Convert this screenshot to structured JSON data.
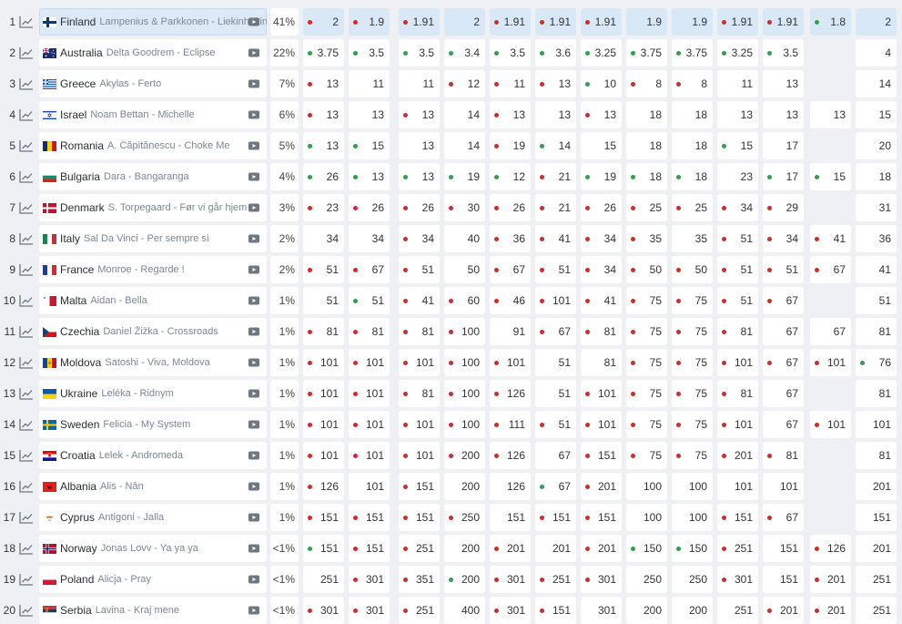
{
  "columns_left": [
    333,
    383,
    438,
    488,
    538,
    588,
    638,
    688,
    738,
    788,
    838,
    890,
    940
  ],
  "rows": [
    {
      "rank": "1",
      "country": "Finland",
      "song": "Lampenius & Parkkonen - Liekinheitin",
      "pct": "41%",
      "flag": "fi",
      "highlight": true,
      "odds": [
        {
          "v": "2",
          "d": "dn"
        },
        {
          "v": "1.9",
          "d": "dn"
        },
        {
          "v": "1.91",
          "d": "dn"
        },
        {
          "v": "2",
          "d": ""
        },
        {
          "v": "1.91",
          "d": "dn"
        },
        {
          "v": "1.91",
          "d": "dn"
        },
        {
          "v": "1.91",
          "d": "dn"
        },
        {
          "v": "1.9",
          "d": ""
        },
        {
          "v": "1.9",
          "d": ""
        },
        {
          "v": "1.91",
          "d": "dn"
        },
        {
          "v": "1.91",
          "d": "dn"
        },
        {
          "v": "1.8",
          "d": "up"
        },
        {
          "v": "2",
          "d": ""
        }
      ]
    },
    {
      "rank": "2",
      "country": "Australia",
      "song": "Delta Goodrem - Eclipse",
      "pct": "22%",
      "flag": "au",
      "odds": [
        {
          "v": "3.75",
          "d": "up"
        },
        {
          "v": "3.5",
          "d": "up"
        },
        {
          "v": "3.5",
          "d": "up"
        },
        {
          "v": "3.4",
          "d": "up"
        },
        {
          "v": "3.5",
          "d": "up"
        },
        {
          "v": "3.6",
          "d": "up"
        },
        {
          "v": "3.25",
          "d": "up"
        },
        {
          "v": "3.75",
          "d": "up"
        },
        {
          "v": "3.75",
          "d": "up"
        },
        {
          "v": "3.25",
          "d": "up"
        },
        {
          "v": "3.5",
          "d": "up"
        },
        {
          "v": "",
          "d": ""
        },
        {
          "v": "4",
          "d": ""
        }
      ]
    },
    {
      "rank": "3",
      "country": "Greece",
      "song": "Akylas - Ferto",
      "pct": "7%",
      "flag": "gr",
      "odds": [
        {
          "v": "13",
          "d": "dn"
        },
        {
          "v": "11",
          "d": ""
        },
        {
          "v": "11",
          "d": ""
        },
        {
          "v": "12",
          "d": "dn"
        },
        {
          "v": "11",
          "d": "dn"
        },
        {
          "v": "13",
          "d": "dn"
        },
        {
          "v": "10",
          "d": "up"
        },
        {
          "v": "8",
          "d": "dn"
        },
        {
          "v": "8",
          "d": "dn"
        },
        {
          "v": "11",
          "d": ""
        },
        {
          "v": "13",
          "d": ""
        },
        {
          "v": "",
          "d": ""
        },
        {
          "v": "14",
          "d": ""
        }
      ]
    },
    {
      "rank": "4",
      "country": "Israel",
      "song": "Noam Bettan - Michelle",
      "pct": "6%",
      "flag": "il",
      "odds": [
        {
          "v": "13",
          "d": "dn"
        },
        {
          "v": "13",
          "d": ""
        },
        {
          "v": "13",
          "d": "dn"
        },
        {
          "v": "14",
          "d": ""
        },
        {
          "v": "13",
          "d": "dn"
        },
        {
          "v": "13",
          "d": ""
        },
        {
          "v": "13",
          "d": "dn"
        },
        {
          "v": "18",
          "d": ""
        },
        {
          "v": "18",
          "d": ""
        },
        {
          "v": "13",
          "d": ""
        },
        {
          "v": "13",
          "d": ""
        },
        {
          "v": "13",
          "d": ""
        },
        {
          "v": "15",
          "d": ""
        }
      ]
    },
    {
      "rank": "5",
      "country": "Romania",
      "song": "A. Căpitănescu - Choke Me",
      "pct": "5%",
      "flag": "ro",
      "odds": [
        {
          "v": "13",
          "d": "up"
        },
        {
          "v": "15",
          "d": "up"
        },
        {
          "v": "13",
          "d": ""
        },
        {
          "v": "14",
          "d": ""
        },
        {
          "v": "19",
          "d": "dn"
        },
        {
          "v": "14",
          "d": "up"
        },
        {
          "v": "15",
          "d": ""
        },
        {
          "v": "18",
          "d": ""
        },
        {
          "v": "18",
          "d": ""
        },
        {
          "v": "15",
          "d": "up"
        },
        {
          "v": "17",
          "d": ""
        },
        {
          "v": "",
          "d": ""
        },
        {
          "v": "20",
          "d": ""
        }
      ]
    },
    {
      "rank": "6",
      "country": "Bulgaria",
      "song": "Dara - Bangaranga",
      "pct": "4%",
      "flag": "bg",
      "odds": [
        {
          "v": "26",
          "d": "up"
        },
        {
          "v": "13",
          "d": "up"
        },
        {
          "v": "13",
          "d": "up"
        },
        {
          "v": "19",
          "d": "up"
        },
        {
          "v": "12",
          "d": "up"
        },
        {
          "v": "21",
          "d": "dn"
        },
        {
          "v": "19",
          "d": "up"
        },
        {
          "v": "18",
          "d": "up"
        },
        {
          "v": "18",
          "d": "up"
        },
        {
          "v": "23",
          "d": ""
        },
        {
          "v": "17",
          "d": "up"
        },
        {
          "v": "15",
          "d": "up"
        },
        {
          "v": "18",
          "d": ""
        }
      ]
    },
    {
      "rank": "7",
      "country": "Denmark",
      "song": "S. Torpegaard - Før vi går hjem",
      "pct": "3%",
      "flag": "dk",
      "odds": [
        {
          "v": "23",
          "d": "dn"
        },
        {
          "v": "26",
          "d": "dn"
        },
        {
          "v": "26",
          "d": "dn"
        },
        {
          "v": "30",
          "d": "dn"
        },
        {
          "v": "26",
          "d": "dn"
        },
        {
          "v": "21",
          "d": "dn"
        },
        {
          "v": "26",
          "d": "dn"
        },
        {
          "v": "25",
          "d": "dn"
        },
        {
          "v": "25",
          "d": "dn"
        },
        {
          "v": "34",
          "d": "dn"
        },
        {
          "v": "29",
          "d": "dn"
        },
        {
          "v": "",
          "d": ""
        },
        {
          "v": "31",
          "d": ""
        }
      ]
    },
    {
      "rank": "8",
      "country": "Italy",
      "song": "Sal Da Vinci - Per sempre sì",
      "pct": "2%",
      "flag": "it",
      "odds": [
        {
          "v": "34",
          "d": ""
        },
        {
          "v": "34",
          "d": ""
        },
        {
          "v": "34",
          "d": "dn"
        },
        {
          "v": "40",
          "d": ""
        },
        {
          "v": "36",
          "d": "dn"
        },
        {
          "v": "41",
          "d": "dn"
        },
        {
          "v": "34",
          "d": "dn"
        },
        {
          "v": "35",
          "d": "dn"
        },
        {
          "v": "35",
          "d": ""
        },
        {
          "v": "51",
          "d": "dn"
        },
        {
          "v": "34",
          "d": "dn"
        },
        {
          "v": "41",
          "d": "dn"
        },
        {
          "v": "36",
          "d": ""
        }
      ]
    },
    {
      "rank": "9",
      "country": "France",
      "song": "Monroe - Regarde !",
      "pct": "2%",
      "flag": "fr",
      "odds": [
        {
          "v": "51",
          "d": "dn"
        },
        {
          "v": "67",
          "d": "dn"
        },
        {
          "v": "51",
          "d": "dn"
        },
        {
          "v": "50",
          "d": ""
        },
        {
          "v": "67",
          "d": "dn"
        },
        {
          "v": "51",
          "d": "dn"
        },
        {
          "v": "34",
          "d": "dn"
        },
        {
          "v": "50",
          "d": "dn"
        },
        {
          "v": "50",
          "d": "dn"
        },
        {
          "v": "51",
          "d": "dn"
        },
        {
          "v": "51",
          "d": "dn"
        },
        {
          "v": "67",
          "d": "dn"
        },
        {
          "v": "41",
          "d": ""
        }
      ]
    },
    {
      "rank": "10",
      "country": "Malta",
      "song": "Aidan - Bella",
      "pct": "1%",
      "flag": "mt",
      "odds": [
        {
          "v": "51",
          "d": ""
        },
        {
          "v": "51",
          "d": "up"
        },
        {
          "v": "41",
          "d": "dn"
        },
        {
          "v": "60",
          "d": "dn"
        },
        {
          "v": "46",
          "d": "dn"
        },
        {
          "v": "101",
          "d": "dn"
        },
        {
          "v": "41",
          "d": "dn"
        },
        {
          "v": "75",
          "d": "dn"
        },
        {
          "v": "75",
          "d": "dn"
        },
        {
          "v": "51",
          "d": "dn"
        },
        {
          "v": "67",
          "d": "dn"
        },
        {
          "v": "",
          "d": ""
        },
        {
          "v": "51",
          "d": ""
        }
      ]
    },
    {
      "rank": "11",
      "country": "Czechia",
      "song": "Daniel Žižka - Crossroads",
      "pct": "1%",
      "flag": "cz",
      "odds": [
        {
          "v": "81",
          "d": "dn"
        },
        {
          "v": "81",
          "d": "dn"
        },
        {
          "v": "81",
          "d": "dn"
        },
        {
          "v": "100",
          "d": "dn"
        },
        {
          "v": "91",
          "d": ""
        },
        {
          "v": "67",
          "d": "dn"
        },
        {
          "v": "81",
          "d": "dn"
        },
        {
          "v": "75",
          "d": "dn"
        },
        {
          "v": "75",
          "d": "dn"
        },
        {
          "v": "81",
          "d": "dn"
        },
        {
          "v": "67",
          "d": ""
        },
        {
          "v": "67",
          "d": ""
        },
        {
          "v": "81",
          "d": ""
        }
      ]
    },
    {
      "rank": "12",
      "country": "Moldova",
      "song": "Satoshi - Viva, Moldova",
      "pct": "1%",
      "flag": "md",
      "odds": [
        {
          "v": "101",
          "d": "dn"
        },
        {
          "v": "101",
          "d": "dn"
        },
        {
          "v": "101",
          "d": "dn"
        },
        {
          "v": "100",
          "d": "dn"
        },
        {
          "v": "101",
          "d": "dn"
        },
        {
          "v": "51",
          "d": ""
        },
        {
          "v": "81",
          "d": ""
        },
        {
          "v": "75",
          "d": "dn"
        },
        {
          "v": "75",
          "d": "dn"
        },
        {
          "v": "101",
          "d": "dn"
        },
        {
          "v": "67",
          "d": "dn"
        },
        {
          "v": "101",
          "d": "dn"
        },
        {
          "v": "76",
          "d": "up"
        }
      ]
    },
    {
      "rank": "13",
      "country": "Ukraine",
      "song": "Leléka - Ridnym",
      "pct": "1%",
      "flag": "ua",
      "odds": [
        {
          "v": "101",
          "d": "dn"
        },
        {
          "v": "101",
          "d": "dn"
        },
        {
          "v": "81",
          "d": "dn"
        },
        {
          "v": "100",
          "d": "dn"
        },
        {
          "v": "126",
          "d": "dn"
        },
        {
          "v": "51",
          "d": ""
        },
        {
          "v": "101",
          "d": "dn"
        },
        {
          "v": "75",
          "d": "dn"
        },
        {
          "v": "75",
          "d": "dn"
        },
        {
          "v": "81",
          "d": "dn"
        },
        {
          "v": "67",
          "d": ""
        },
        {
          "v": "",
          "d": ""
        },
        {
          "v": "81",
          "d": ""
        }
      ]
    },
    {
      "rank": "14",
      "country": "Sweden",
      "song": "Felicia - My System",
      "pct": "1%",
      "flag": "se",
      "odds": [
        {
          "v": "101",
          "d": "dn"
        },
        {
          "v": "101",
          "d": "dn"
        },
        {
          "v": "101",
          "d": "dn"
        },
        {
          "v": "100",
          "d": "dn"
        },
        {
          "v": "111",
          "d": "dn"
        },
        {
          "v": "51",
          "d": "dn"
        },
        {
          "v": "101",
          "d": "dn"
        },
        {
          "v": "75",
          "d": "dn"
        },
        {
          "v": "75",
          "d": "dn"
        },
        {
          "v": "101",
          "d": "dn"
        },
        {
          "v": "67",
          "d": ""
        },
        {
          "v": "101",
          "d": "dn"
        },
        {
          "v": "101",
          "d": ""
        }
      ]
    },
    {
      "rank": "15",
      "country": "Croatia",
      "song": "Lelek - Andromeda",
      "pct": "1%",
      "flag": "hr",
      "odds": [
        {
          "v": "101",
          "d": "dn"
        },
        {
          "v": "101",
          "d": "dn"
        },
        {
          "v": "101",
          "d": "dn"
        },
        {
          "v": "200",
          "d": "dn"
        },
        {
          "v": "126",
          "d": "dn"
        },
        {
          "v": "67",
          "d": ""
        },
        {
          "v": "151",
          "d": "dn"
        },
        {
          "v": "75",
          "d": "dn"
        },
        {
          "v": "75",
          "d": "dn"
        },
        {
          "v": "201",
          "d": "dn"
        },
        {
          "v": "81",
          "d": "dn"
        },
        {
          "v": "",
          "d": ""
        },
        {
          "v": "81",
          "d": ""
        }
      ]
    },
    {
      "rank": "16",
      "country": "Albania",
      "song": "Alis - Nân",
      "pct": "1%",
      "flag": "al",
      "odds": [
        {
          "v": "126",
          "d": "dn"
        },
        {
          "v": "101",
          "d": ""
        },
        {
          "v": "151",
          "d": "dn"
        },
        {
          "v": "200",
          "d": ""
        },
        {
          "v": "126",
          "d": ""
        },
        {
          "v": "67",
          "d": "up"
        },
        {
          "v": "201",
          "d": "dn"
        },
        {
          "v": "100",
          "d": ""
        },
        {
          "v": "100",
          "d": ""
        },
        {
          "v": "101",
          "d": ""
        },
        {
          "v": "101",
          "d": ""
        },
        {
          "v": "",
          "d": ""
        },
        {
          "v": "201",
          "d": ""
        }
      ]
    },
    {
      "rank": "17",
      "country": "Cyprus",
      "song": "Antigoni - Jalla",
      "pct": "1%",
      "flag": "cy",
      "odds": [
        {
          "v": "151",
          "d": "dn"
        },
        {
          "v": "151",
          "d": "dn"
        },
        {
          "v": "151",
          "d": "dn"
        },
        {
          "v": "250",
          "d": "dn"
        },
        {
          "v": "151",
          "d": ""
        },
        {
          "v": "151",
          "d": "dn"
        },
        {
          "v": "151",
          "d": "dn"
        },
        {
          "v": "100",
          "d": ""
        },
        {
          "v": "100",
          "d": ""
        },
        {
          "v": "151",
          "d": "dn"
        },
        {
          "v": "67",
          "d": "dn"
        },
        {
          "v": "",
          "d": ""
        },
        {
          "v": "151",
          "d": ""
        }
      ]
    },
    {
      "rank": "18",
      "country": "Norway",
      "song": "Jonas Lovv - Ya ya ya",
      "pct": "<1%",
      "flag": "no",
      "odds": [
        {
          "v": "151",
          "d": "up"
        },
        {
          "v": "151",
          "d": "dn"
        },
        {
          "v": "251",
          "d": "dn"
        },
        {
          "v": "200",
          "d": ""
        },
        {
          "v": "201",
          "d": "dn"
        },
        {
          "v": "201",
          "d": ""
        },
        {
          "v": "201",
          "d": "dn"
        },
        {
          "v": "150",
          "d": "up"
        },
        {
          "v": "150",
          "d": "up"
        },
        {
          "v": "251",
          "d": "dn"
        },
        {
          "v": "151",
          "d": ""
        },
        {
          "v": "126",
          "d": "dn"
        },
        {
          "v": "201",
          "d": ""
        }
      ]
    },
    {
      "rank": "19",
      "country": "Poland",
      "song": "Alicja - Pray",
      "pct": "<1%",
      "flag": "pl",
      "odds": [
        {
          "v": "251",
          "d": ""
        },
        {
          "v": "301",
          "d": "dn"
        },
        {
          "v": "351",
          "d": "dn"
        },
        {
          "v": "200",
          "d": "up"
        },
        {
          "v": "301",
          "d": "dn"
        },
        {
          "v": "251",
          "d": "dn"
        },
        {
          "v": "301",
          "d": "dn"
        },
        {
          "v": "250",
          "d": ""
        },
        {
          "v": "250",
          "d": ""
        },
        {
          "v": "301",
          "d": "dn"
        },
        {
          "v": "151",
          "d": ""
        },
        {
          "v": "201",
          "d": "dn"
        },
        {
          "v": "251",
          "d": ""
        }
      ]
    },
    {
      "rank": "20",
      "country": "Serbia",
      "song": "Lavina - Kraj mene",
      "pct": "<1%",
      "flag": "rs",
      "odds": [
        {
          "v": "301",
          "d": "dn"
        },
        {
          "v": "301",
          "d": "dn"
        },
        {
          "v": "251",
          "d": "dn"
        },
        {
          "v": "400",
          "d": ""
        },
        {
          "v": "301",
          "d": "dn"
        },
        {
          "v": "151",
          "d": "dn"
        },
        {
          "v": "301",
          "d": ""
        },
        {
          "v": "200",
          "d": ""
        },
        {
          "v": "200",
          "d": ""
        },
        {
          "v": "251",
          "d": ""
        },
        {
          "v": "201",
          "d": "dn"
        },
        {
          "v": "201",
          "d": "dn"
        },
        {
          "v": "251",
          "d": ""
        }
      ]
    }
  ],
  "icons": {
    "trend": "trend-chart-icon",
    "video": "video-play-icon"
  }
}
